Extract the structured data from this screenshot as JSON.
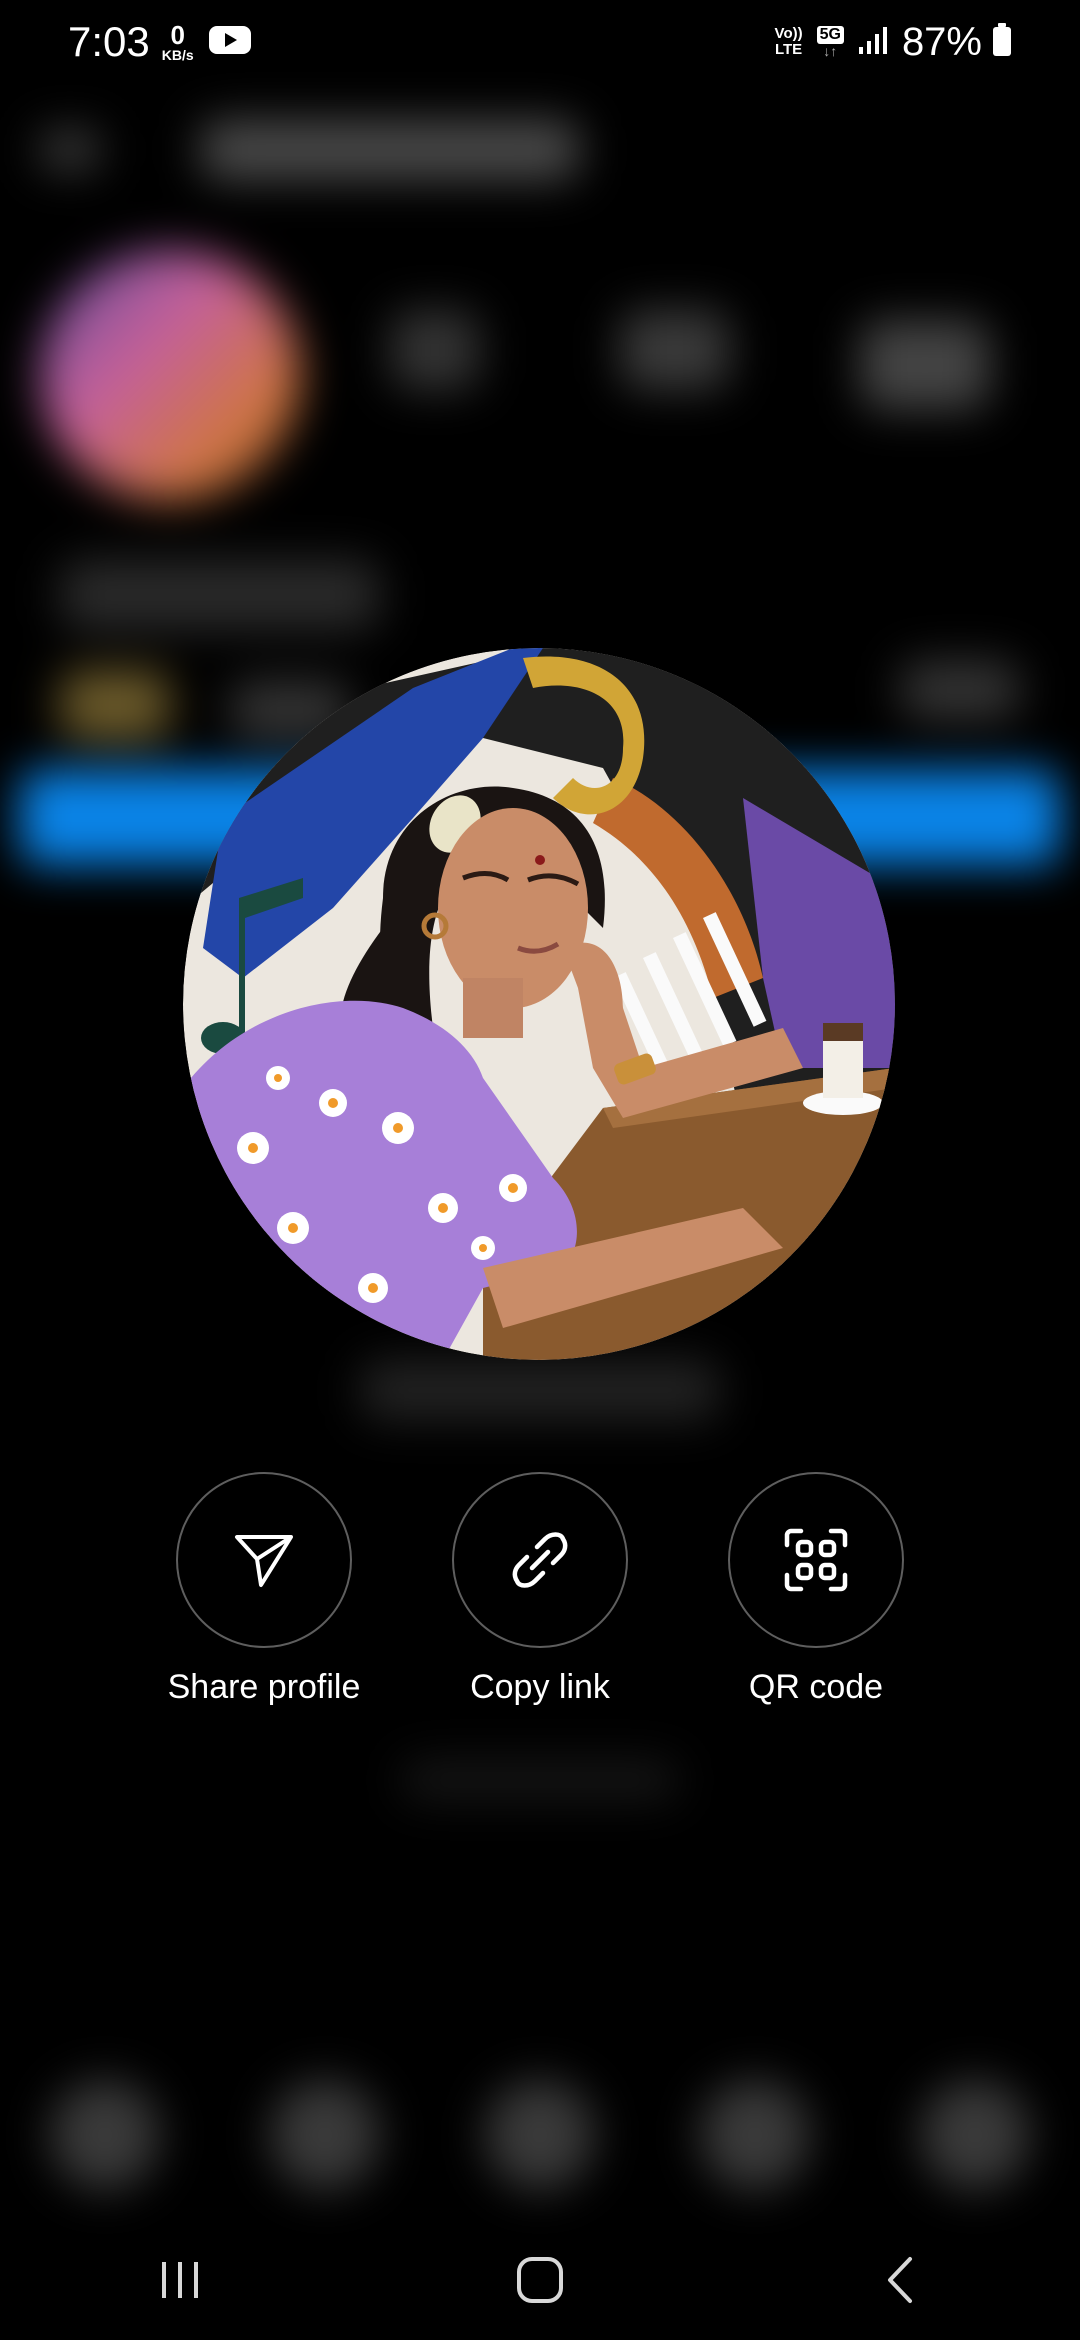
{
  "status_bar": {
    "time": "7:03",
    "net_speed_value": "0",
    "net_speed_unit": "KB/s",
    "volte_top": "Vo))",
    "volte_bottom": "LTE",
    "network_type": "5G",
    "battery_percent": "87%",
    "icons": [
      "youtube-icon",
      "signal-icon",
      "battery-icon"
    ]
  },
  "profile_photo": {
    "description_icon": "profile-photo"
  },
  "actions": [
    {
      "label": "Share profile",
      "icon": "send-icon"
    },
    {
      "label": "Copy link",
      "icon": "link-icon"
    },
    {
      "label": "QR code",
      "icon": "qr-scan-icon"
    }
  ],
  "nav_bar": {
    "icons": [
      "recent-apps-icon",
      "home-icon",
      "back-icon"
    ]
  },
  "colors": {
    "background": "#000000",
    "accent_blurred_button": "#0a84e8",
    "action_border": "#5e5e5e"
  }
}
